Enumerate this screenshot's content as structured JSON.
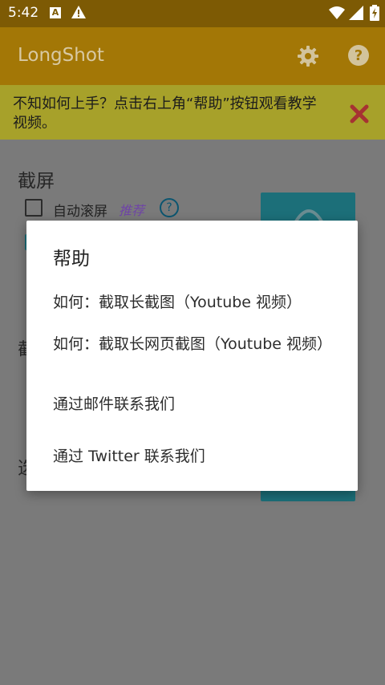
{
  "status_bar": {
    "time": "5:42",
    "notification_icons": [
      "a-icon",
      "warning-icon"
    ],
    "system_icons": [
      "wifi-icon",
      "signal-icon",
      "battery-charging-icon"
    ]
  },
  "toolbar": {
    "title": "LongShot",
    "settings_icon": "gear-icon",
    "help_icon": "question-icon"
  },
  "hint_banner": {
    "text": "不知如何上手？点击右上角“帮助”按钮观看教学视频。",
    "close_icon": "close-icon"
  },
  "background": {
    "screenshot_section_title": "截屏",
    "auto_scroll_label": "自动滚屏",
    "recommend_label": "推荐",
    "partial_text_1": "截",
    "partial_text_2": "选"
  },
  "dialog": {
    "title": "帮助",
    "items": [
      "如何：截取长截图（Youtube 视频）",
      "如何：截取长网页截图（Youtube 视频）",
      "通过邮件联系我们",
      "通过 Twitter 联系我们"
    ]
  },
  "colors": {
    "status_bar": "#7d5a04",
    "toolbar": "#a37706",
    "hint_banner": "#a7a12a",
    "close_icon": "#a63232",
    "accent": "#1c6f79"
  }
}
